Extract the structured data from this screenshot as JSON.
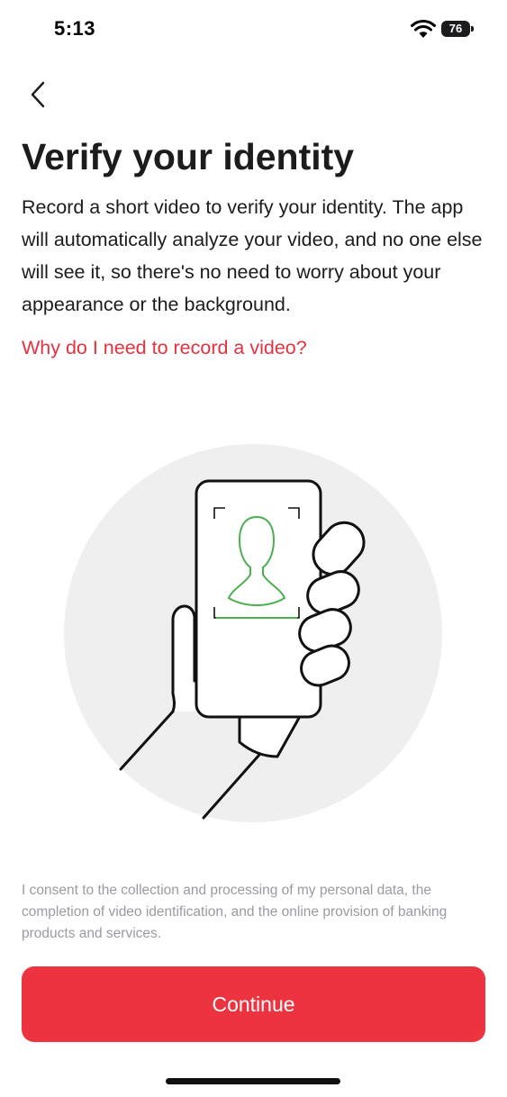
{
  "status_bar": {
    "time": "5:13",
    "battery_level": "76",
    "wifi_icon": "wifi-icon"
  },
  "header": {
    "back_icon": "chevron-left-icon"
  },
  "main": {
    "title": "Verify your identity",
    "description": "Record a short video to verify your identity. The app will automatically analyze your video, and no one else will see it, so there's no need to worry about your appearance or the background.",
    "why_link": "Why do I need to record a video?",
    "illustration": "hand-holding-phone-face-scan-illustration"
  },
  "footer": {
    "consent": "I consent to the collection and processing of my personal data, the completion of video identification, and the online provision of banking products and services.",
    "continue_label": "Continue"
  },
  "colors": {
    "accent": "#ee3340",
    "link": "#e5323f",
    "scan_green": "#4caf50",
    "illustration_bg": "#efefef",
    "muted_text": "#9a9aa6"
  }
}
